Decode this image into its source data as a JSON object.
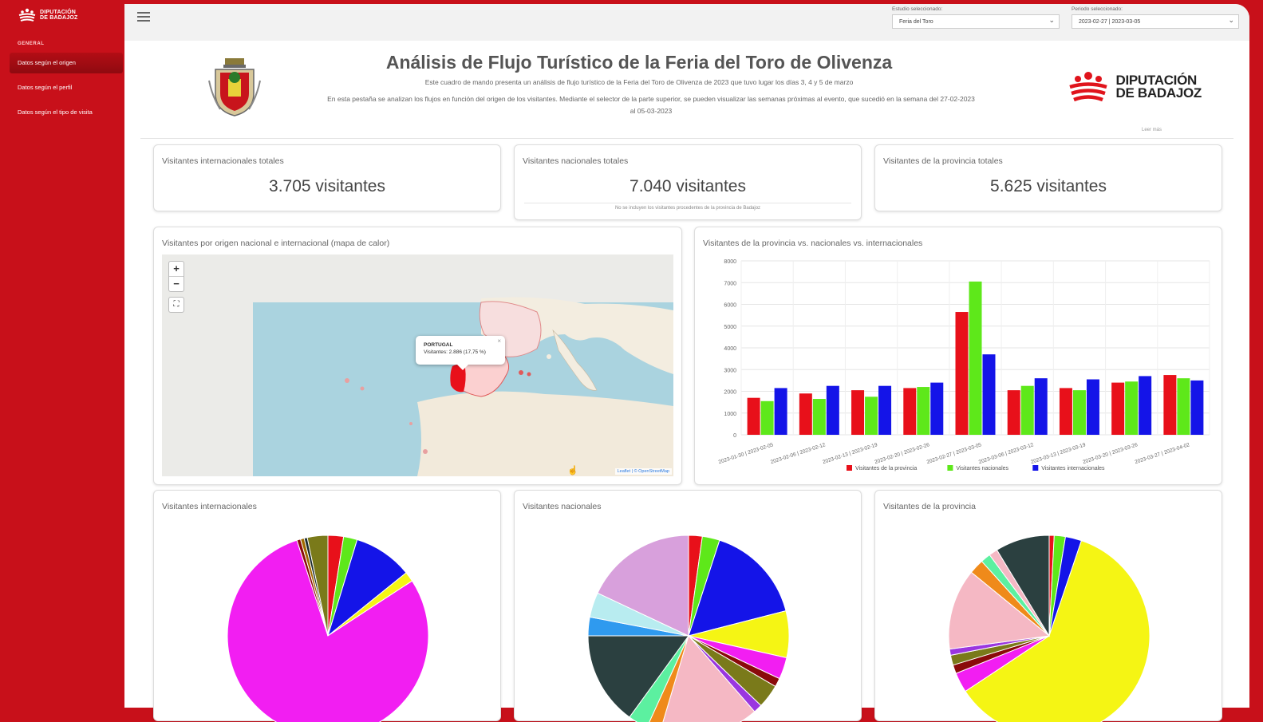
{
  "sidebar": {
    "brand_line1": "DIPUTACIÓN",
    "brand_line2": "DE BADAJOZ",
    "section": "GENERAL",
    "items": [
      {
        "label": "Datos según el origen"
      },
      {
        "label": "Datos según el perfil"
      },
      {
        "label": "Datos según el tipo de visita"
      }
    ]
  },
  "topbar": {
    "study_label": "Estudio seleccionado:",
    "study_value": "Feria del Toro",
    "period_label": "Periodo seleccionado:",
    "period_value": "2023-02-27 | 2023-03-05"
  },
  "header": {
    "title": "Análisis de Flujo Turístico de la Feria del Toro de Olivenza",
    "subtitle1": "Este cuadro de mando presenta un análisis de flujo turístico de la Feria del Toro de Olivenza de 2023 que tuvo lugar los días 3, 4 y 5 de marzo",
    "subtitle2": "En esta pestaña se analizan los flujos en función del origen de los visitantes. Mediante el selector de la parte superior, se pueden visualizar las semanas próximas al evento, que sucedió en la semana del 27-02-2023 al 05-03-2023",
    "read_more": "Leer más",
    "logo_line1": "DIPUTACIÓN",
    "logo_line2": "DE BADAJOZ"
  },
  "kpis": [
    {
      "title": "Visitantes internacionales totales",
      "value": "3.705 visitantes",
      "note": ""
    },
    {
      "title": "Visitantes nacionales totales",
      "value": "7.040 visitantes",
      "note": "No se incluyen los visitantes procedentes de la provincia de Badajoz"
    },
    {
      "title": "Visitantes de la provincia totales",
      "value": "5.625 visitantes",
      "note": ""
    }
  ],
  "map_card": {
    "title": "Visitantes por origen nacional e internacional (mapa de calor)",
    "zoom_in": "+",
    "zoom_out": "−",
    "popup_title": "PORTUGAL",
    "popup_text": "Visitantes: 2.886 (17,75 %)",
    "attribution": "Leaflet | © OpenStreetMap"
  },
  "colors": {
    "provincia": "#e8101a",
    "nacionales": "#5ee81a",
    "internacionales": "#1414e8",
    "brand_red": "#c8101a"
  },
  "bar_card": {
    "title": "Visitantes de la provincia vs. nacionales vs. internacionales"
  },
  "chart_data": [
    {
      "type": "bar",
      "categories": [
        "2023-01-30 | 2023-02-05",
        "2023-02-06 | 2023-02-12",
        "2023-02-13 | 2023-02-19",
        "2023-02-20 | 2023-02-26",
        "2023-02-27 | 2023-03-05",
        "2023-03-06 | 2023-03-12",
        "2023-03-13 | 2023-03-19",
        "2023-03-20 | 2023-03-26",
        "2023-03-27 | 2023-04-02"
      ],
      "series": [
        {
          "name": "Visitantes de la provincia",
          "color": "#e8101a",
          "values": [
            1700,
            1900,
            2050,
            2150,
            5650,
            2050,
            2150,
            2400,
            2750
          ]
        },
        {
          "name": "Visitantes nacionales",
          "color": "#5ee81a",
          "values": [
            1550,
            1650,
            1750,
            2200,
            7050,
            2250,
            2050,
            2450,
            2600
          ]
        },
        {
          "name": "Visitantes internacionales",
          "color": "#1414e8",
          "values": [
            2150,
            2250,
            2250,
            2400,
            3700,
            2600,
            2550,
            2700,
            2500
          ]
        }
      ],
      "y_ticks": [
        "0",
        "1000",
        "2000",
        "3000",
        "4000",
        "5000",
        "6000",
        "7000",
        "8000"
      ],
      "ylim": [
        0,
        8000
      ],
      "legend": "bottom",
      "grid": true
    },
    {
      "type": "pie",
      "title": "Visitantes internacionales",
      "slices": [
        {
          "value": 2.5,
          "color": "#e8101a"
        },
        {
          "value": 2.2,
          "color": "#5ee81a"
        },
        {
          "value": 9.5,
          "color": "#1414e8"
        },
        {
          "value": 1.6,
          "color": "#f5f514"
        },
        {
          "value": 79.2,
          "color": "#f21ef2"
        },
        {
          "value": 0.6,
          "color": "#8a0a0a"
        },
        {
          "value": 0.6,
          "color": "#a06a00"
        },
        {
          "value": 0.5,
          "color": "#1c2b2c"
        },
        {
          "value": 3.3,
          "color": "#7a7a1a"
        }
      ]
    },
    {
      "type": "pie",
      "title": "Visitantes nacionales",
      "slices": [
        {
          "value": 2.2,
          "color": "#e8101a"
        },
        {
          "value": 2.8,
          "color": "#5ee81a"
        },
        {
          "value": 16.0,
          "color": "#1414e8"
        },
        {
          "value": 7.5,
          "color": "#f5f514"
        },
        {
          "value": 3.5,
          "color": "#f21ef2"
        },
        {
          "value": 1.4,
          "color": "#8a0a0a"
        },
        {
          "value": 3.8,
          "color": "#7a7a1a"
        },
        {
          "value": 1.4,
          "color": "#9a36e0"
        },
        {
          "value": 16.0,
          "color": "#f5b8c4"
        },
        {
          "value": 2.2,
          "color": "#ef8a1a"
        },
        {
          "value": 3.2,
          "color": "#5cf0a0"
        },
        {
          "value": 15.0,
          "color": "#2b4040"
        },
        {
          "value": 3.0,
          "color": "#2f9aef"
        },
        {
          "value": 4.0,
          "color": "#b8ecf0"
        },
        {
          "value": 18.0,
          "color": "#d8a0dc"
        }
      ]
    },
    {
      "type": "pie",
      "title": "Visitantes de la provincia",
      "slices": [
        {
          "value": 0.8,
          "color": "#e8101a"
        },
        {
          "value": 1.8,
          "color": "#5ee81a"
        },
        {
          "value": 2.6,
          "color": "#1414e8"
        },
        {
          "value": 60.5,
          "color": "#f5f514"
        },
        {
          "value": 3.2,
          "color": "#f21ef2"
        },
        {
          "value": 1.4,
          "color": "#8a0a0a"
        },
        {
          "value": 1.6,
          "color": "#7a7a1a"
        },
        {
          "value": 1.0,
          "color": "#9a36e0"
        },
        {
          "value": 13.0,
          "color": "#f5b8c4"
        },
        {
          "value": 2.4,
          "color": "#ef8a1a"
        },
        {
          "value": 1.6,
          "color": "#5cf0a0"
        },
        {
          "value": 1.4,
          "color": "#f5b8c4"
        },
        {
          "value": 8.7,
          "color": "#2b4040"
        }
      ]
    }
  ]
}
